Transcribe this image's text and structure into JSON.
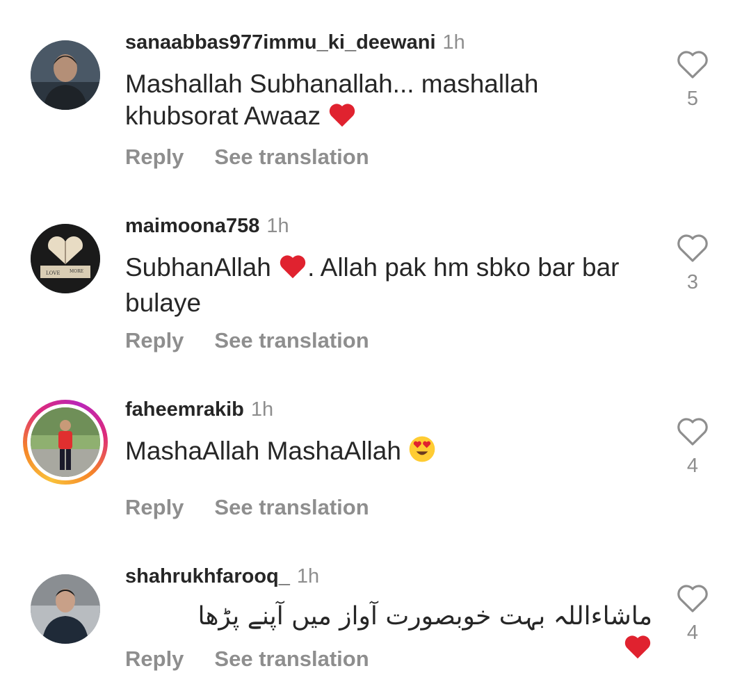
{
  "comments": [
    {
      "username": "sanaabbas977immu_ki_deewani",
      "time": "1h",
      "text_line1": "Mashallah Subhanallah... mashallah",
      "text_line2": "khubsorat Awaaz",
      "emoji": "red-heart-emoji",
      "likes": "5",
      "reply": "Reply",
      "translate": "See translation"
    },
    {
      "username": "maimoona758",
      "time": "1h",
      "text_part1": "SubhanAllah",
      "text_part2": ". Allah pak hm sbko bar bar",
      "text_line2": "bulaye",
      "emoji": "red-heart-emoji",
      "avatar_text_left": "LOVE",
      "avatar_text_right": "MORE",
      "likes": "3",
      "reply": "Reply",
      "translate": "See translation"
    },
    {
      "username": "faheemrakib",
      "time": "1h",
      "text": "MashaAllah MashaAllah",
      "emoji": "heart-eyes-emoji",
      "has_story": true,
      "likes": "4",
      "reply": "Reply",
      "translate": "See translation"
    },
    {
      "username": "shahrukhfarooq_",
      "time": "1h",
      "text": "ماشاءاللہ بہت خوبصورت آواز میں آپنے پڑھا",
      "emoji": "red-heart-emoji",
      "likes": "4",
      "reply": "Reply",
      "translate": "See translation"
    }
  ],
  "colors": {
    "text": "#262626",
    "secondary": "#8e8e8e",
    "heart_red": "#e0222f",
    "story_ring": [
      "#f9c13a",
      "#f58529",
      "#dd2a7b",
      "#b926b9"
    ]
  },
  "icons": {
    "like": "heart-outline-icon"
  }
}
